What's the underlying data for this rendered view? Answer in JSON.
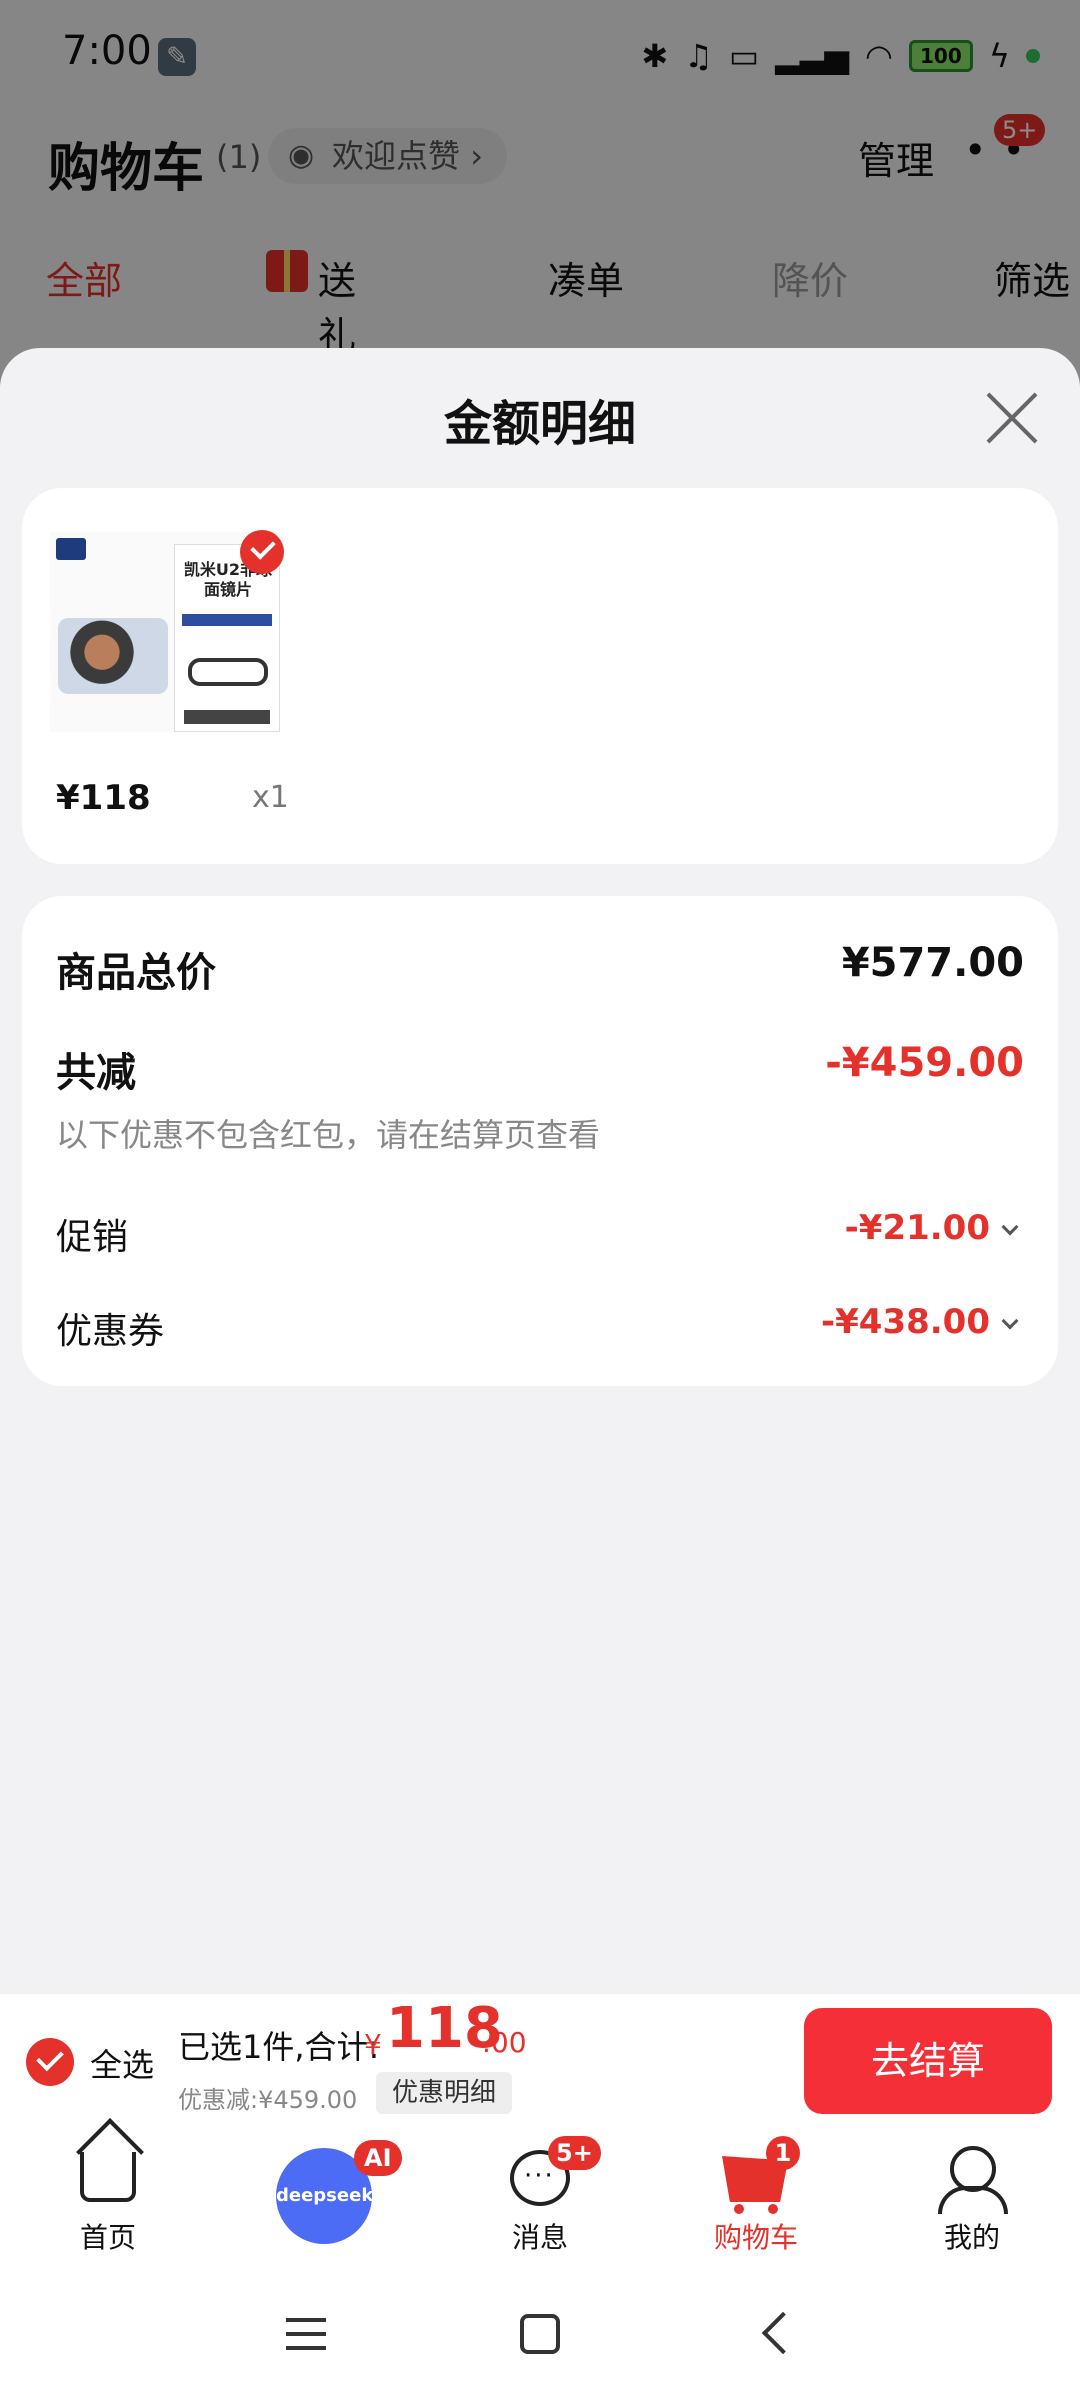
{
  "status_bar": {
    "time": "7:00",
    "battery": "100"
  },
  "cart_header": {
    "title": "购物车",
    "count": "(1)",
    "like_text": "欢迎点赞",
    "manage": "管理",
    "more_badge": "5+"
  },
  "filter_tabs": [
    "全部",
    "送礼",
    "凑单",
    "降价",
    "筛选"
  ],
  "sheet": {
    "title": "金额明细",
    "product": {
      "thumb_title": "凯米U2非球面镜片",
      "price": "¥118",
      "qty": "x1"
    },
    "summary": {
      "total_label": "商品总价",
      "total_value": "¥577.00",
      "reduce_label": "共减",
      "reduce_value": "-¥459.00",
      "note": "以下优惠不包含红包，请在结算页查看",
      "promo_label": "促销",
      "promo_value": "-¥21.00",
      "coupon_label": "优惠券",
      "coupon_value": "-¥438.00"
    }
  },
  "checkout": {
    "select_all": "全选",
    "selected_text": "已选1件,合计:",
    "currency": "¥",
    "total_int": "118",
    "total_dec": ".00",
    "discount_text": "优惠减:¥459.00",
    "detail_button": "优惠明细",
    "checkout_button": "去结算"
  },
  "bottom_nav": {
    "home": "首页",
    "ai_brand": "deepseek",
    "ai_badge": "AI",
    "messages": "消息",
    "messages_badge": "5+",
    "cart": "购物车",
    "cart_badge": "1",
    "me": "我的"
  },
  "colors": {
    "accent": "#e4312b",
    "checkout_button": "#f52f37",
    "ai_blue": "#4d6cf5"
  }
}
